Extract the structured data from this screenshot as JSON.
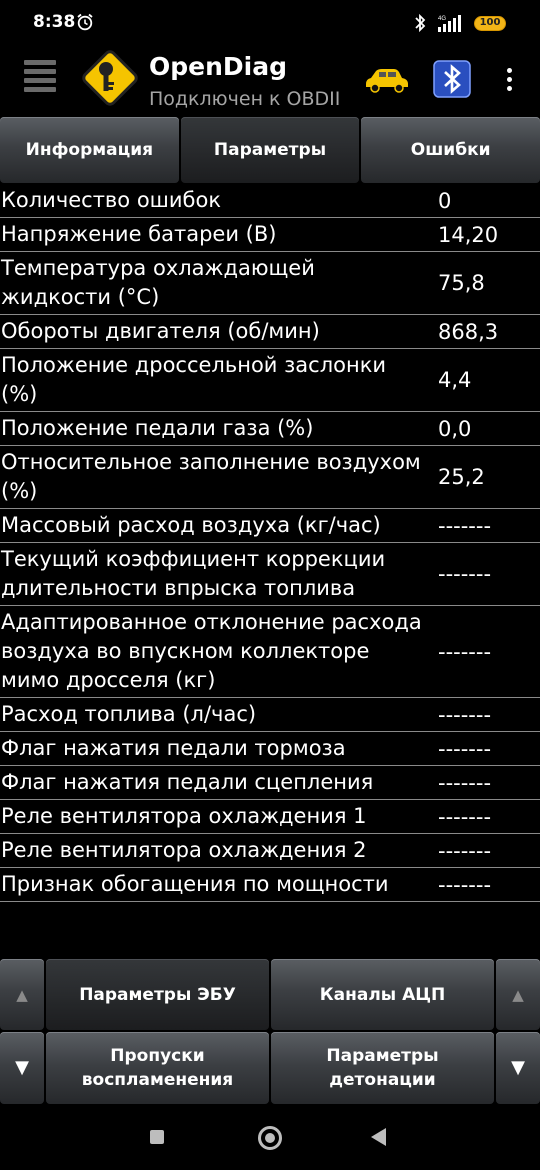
{
  "status": {
    "time": "8:38",
    "network": "4G",
    "battery": "100"
  },
  "app": {
    "title": "OpenDiag",
    "subtitle": "Подключен к OBDII",
    "accent": "#f5c400"
  },
  "tabs": [
    {
      "label": "Информация"
    },
    {
      "label": "Параметры"
    },
    {
      "label": "Ошибки"
    }
  ],
  "params": [
    {
      "name": "Количество ошибок",
      "value": "0"
    },
    {
      "name": "Напряжение батареи (В)",
      "value": "14,20"
    },
    {
      "name": "Температура охлаждающей жидкости (°C)",
      "value": "75,8"
    },
    {
      "name": "Обороты двигателя (об/мин)",
      "value": "868,3"
    },
    {
      "name": "Положение дроссельной заслонки (%)",
      "value": "4,4"
    },
    {
      "name": "Положение педали газа (%)",
      "value": "0,0"
    },
    {
      "name": "Относительное заполнение воздухом (%)",
      "value": "25,2"
    },
    {
      "name": "Массовый расход воздуха (кг/час)",
      "value": "-------"
    },
    {
      "name": "Текущий коэффициент коррекции длительности впрыска топлива",
      "value": "-------"
    },
    {
      "name": "Адаптированное отклонение расхода воздуха во впускном коллекторе мимо дросселя (кг)",
      "value": "-------"
    },
    {
      "name": "Расход топлива (л/час)",
      "value": "-------"
    },
    {
      "name": "Флаг нажатия педали тормоза",
      "value": "-------"
    },
    {
      "name": "Флаг нажатия педали сцепления",
      "value": "-------"
    },
    {
      "name": "Реле вентилятора охлаждения 1",
      "value": "-------"
    },
    {
      "name": "Реле вентилятора охлаждения 2",
      "value": "-------"
    },
    {
      "name": "Признак обогащения по мощности",
      "value": "-------"
    }
  ],
  "controls": {
    "up_arrow": "▲",
    "down_arrow": "▼",
    "ecu_params": "Параметры ЭБУ",
    "adc_channels": "Каналы АЦП",
    "misfires": "Пропуски воспламенения",
    "knock_params": "Параметры детонации"
  }
}
